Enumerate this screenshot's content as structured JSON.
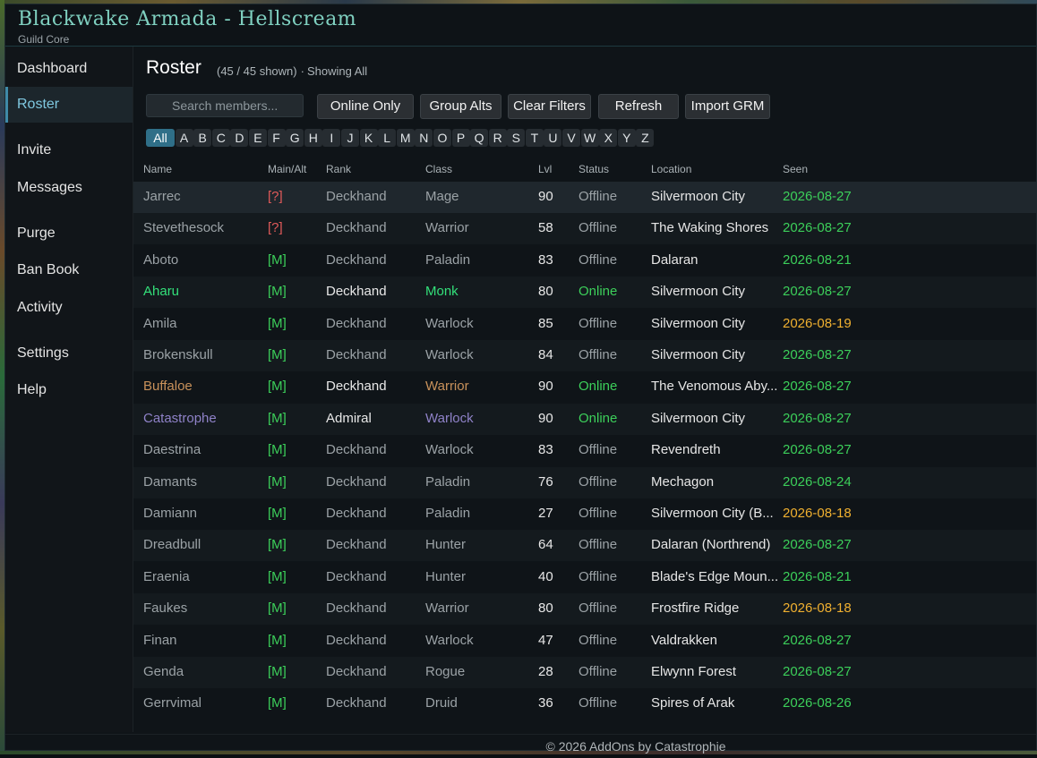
{
  "app": {
    "title": "Blackwake Armada - Hellscream",
    "subtitle": "Guild Core"
  },
  "sidebar": {
    "items": [
      {
        "label": "Dashboard"
      },
      {
        "label": "Roster",
        "active": true
      },
      {
        "label": "Invite"
      },
      {
        "label": "Messages"
      },
      {
        "label": "Purge"
      },
      {
        "label": "Ban Book"
      },
      {
        "label": "Activity"
      },
      {
        "label": "Settings"
      },
      {
        "label": "Help"
      }
    ]
  },
  "roster": {
    "title": "Roster",
    "count": "(45 / 45 shown)",
    "separator": "·",
    "filter_status": "Showing All",
    "search_placeholder": "Search members...",
    "buttons": {
      "online_only": "Online Only",
      "group_alts": "Group Alts",
      "clear_filters": "Clear Filters",
      "refresh": "Refresh",
      "import_grm": "Import GRM"
    },
    "letters": [
      "All",
      "A",
      "B",
      "C",
      "D",
      "E",
      "F",
      "G",
      "H",
      "I",
      "J",
      "K",
      "L",
      "M",
      "N",
      "O",
      "P",
      "Q",
      "R",
      "S",
      "T",
      "U",
      "V",
      "W",
      "X",
      "Y",
      "Z"
    ],
    "columns": {
      "name": "Name",
      "main_alt": "Main/Alt",
      "rank": "Rank",
      "class": "Class",
      "lvl": "Lvl",
      "status": "Status",
      "location": "Location",
      "seen": "Seen"
    },
    "rows": [
      {
        "name": "Jarrec",
        "main": "[?]",
        "rank": "Deckhand",
        "class": "Mage",
        "lvl": "90",
        "status": "Offline",
        "location": "Silvermoon City",
        "seen": "2026-08-27"
      },
      {
        "name": "Stevethesock",
        "main": "[?]",
        "rank": "Deckhand",
        "class": "Warrior",
        "lvl": "58",
        "status": "Offline",
        "location": "The Waking Shores",
        "seen": "2026-08-27"
      },
      {
        "name": "Aboto",
        "main": "[M]",
        "rank": "Deckhand",
        "class": "Paladin",
        "lvl": "83",
        "status": "Offline",
        "location": "Dalaran",
        "seen": "2026-08-21"
      },
      {
        "name": "Aharu",
        "main": "[M]",
        "rank": "Deckhand",
        "class": "Monk",
        "lvl": "80",
        "status": "Online",
        "location": "Silvermoon City",
        "seen": "2026-08-27"
      },
      {
        "name": "Amila",
        "main": "[M]",
        "rank": "Deckhand",
        "class": "Warlock",
        "lvl": "85",
        "status": "Offline",
        "location": "Silvermoon City",
        "seen": "2026-08-19"
      },
      {
        "name": "Brokenskull",
        "main": "[M]",
        "rank": "Deckhand",
        "class": "Warlock",
        "lvl": "84",
        "status": "Offline",
        "location": "Silvermoon City",
        "seen": "2026-08-27"
      },
      {
        "name": "Buffaloe",
        "main": "[M]",
        "rank": "Deckhand",
        "class": "Warrior",
        "lvl": "90",
        "status": "Online",
        "location": "The Venomous Aby...",
        "seen": "2026-08-27"
      },
      {
        "name": "Catastrophe",
        "main": "[M]",
        "rank": "Admiral",
        "class": "Warlock",
        "lvl": "90",
        "status": "Online",
        "location": "Silvermoon City",
        "seen": "2026-08-27"
      },
      {
        "name": "Daestrina",
        "main": "[M]",
        "rank": "Deckhand",
        "class": "Warlock",
        "lvl": "83",
        "status": "Offline",
        "location": "Revendreth",
        "seen": "2026-08-27"
      },
      {
        "name": "Damants",
        "main": "[M]",
        "rank": "Deckhand",
        "class": "Paladin",
        "lvl": "76",
        "status": "Offline",
        "location": "Mechagon",
        "seen": "2026-08-24"
      },
      {
        "name": "Damiann",
        "main": "[M]",
        "rank": "Deckhand",
        "class": "Paladin",
        "lvl": "27",
        "status": "Offline",
        "location": "Silvermoon City (B...",
        "seen": "2026-08-18"
      },
      {
        "name": "Dreadbull",
        "main": "[M]",
        "rank": "Deckhand",
        "class": "Hunter",
        "lvl": "64",
        "status": "Offline",
        "location": "Dalaran (Northrend)",
        "seen": "2026-08-27"
      },
      {
        "name": "Eraenia",
        "main": "[M]",
        "rank": "Deckhand",
        "class": "Hunter",
        "lvl": "40",
        "status": "Offline",
        "location": "Blade's Edge Moun...",
        "seen": "2026-08-21"
      },
      {
        "name": "Faukes",
        "main": "[M]",
        "rank": "Deckhand",
        "class": "Warrior",
        "lvl": "80",
        "status": "Offline",
        "location": "Frostfire Ridge",
        "seen": "2026-08-18"
      },
      {
        "name": "Finan",
        "main": "[M]",
        "rank": "Deckhand",
        "class": "Warlock",
        "lvl": "47",
        "status": "Offline",
        "location": "Valdrakken",
        "seen": "2026-08-27"
      },
      {
        "name": "Genda",
        "main": "[M]",
        "rank": "Deckhand",
        "class": "Rogue",
        "lvl": "28",
        "status": "Offline",
        "location": "Elwynn Forest",
        "seen": "2026-08-27"
      },
      {
        "name": "Gerrvimal",
        "main": "[M]",
        "rank": "Deckhand",
        "class": "Druid",
        "lvl": "36",
        "status": "Offline",
        "location": "Spires of Arak",
        "seen": "2026-08-26"
      }
    ]
  },
  "colors": {
    "accent": "#7fd0c0",
    "unknown_tag": "#e05a5a",
    "main_tag": "#3ccf5a",
    "online": "#3ccf5a",
    "offline": "#9ba2a6",
    "seen_recent": "#3ccf5a",
    "seen_old": "#f0b030",
    "class_monk": "#33e07a",
    "class_warrior": "#c8915a",
    "class_warlock": "#8f82c8"
  },
  "footer": {
    "text": "© 2026 AddOns by Catastrophie"
  }
}
